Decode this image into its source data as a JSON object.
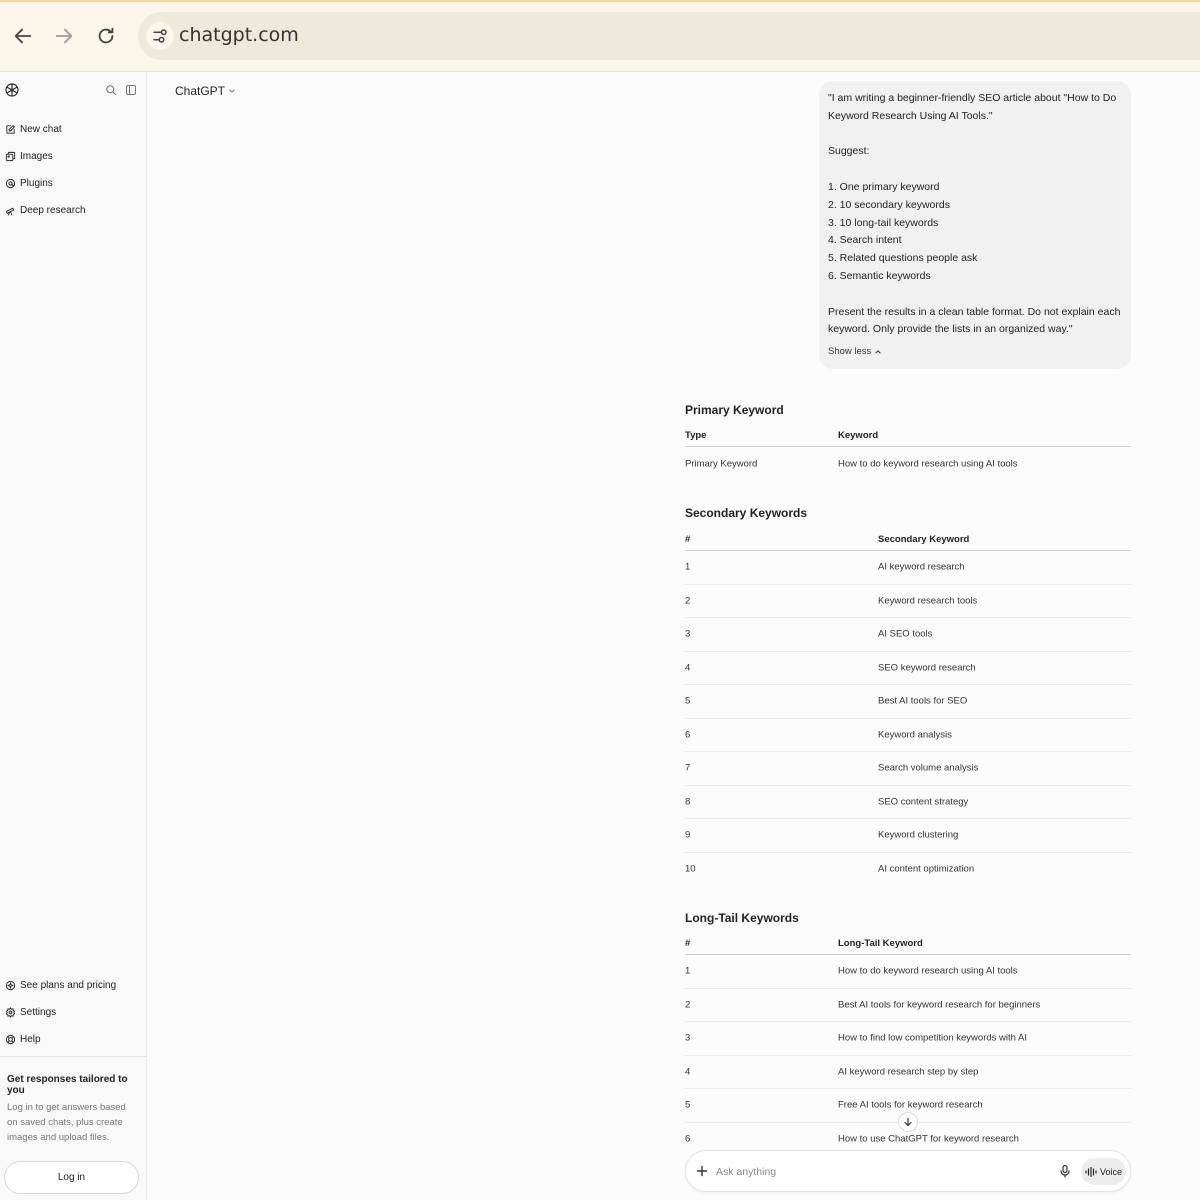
{
  "browser": {
    "url": "chatgpt.com",
    "icons": [
      "back-icon",
      "forward-icon",
      "reload-icon",
      "site-settings-icon"
    ]
  },
  "sidebar": {
    "items": [
      {
        "label": "New chat",
        "icon": "edit-icon"
      },
      {
        "label": "Images",
        "icon": "images-icon"
      },
      {
        "label": "Plugins",
        "icon": "plugins-icon"
      },
      {
        "label": "Deep research",
        "icon": "telescope-icon"
      }
    ],
    "bottom_items": [
      {
        "label": "See plans and pricing",
        "icon": "plans-icon"
      },
      {
        "label": "Settings",
        "icon": "gear-icon"
      },
      {
        "label": "Help",
        "icon": "help-icon"
      }
    ],
    "tailored_title": "Get responses tailored to you",
    "tailored_desc": "Log in to get answers based on saved chats, plus create images and upload files.",
    "login_label": "Log in"
  },
  "header": {
    "model_label": "ChatGPT"
  },
  "user_message": {
    "text": "\"I am writing a beginner-friendly SEO article about \"How to Do Keyword Research Using AI Tools.\"\n\nSuggest:\n\n1. One primary keyword\n2. 10 secondary keywords\n3. 10 long-tail keywords\n4. Search intent\n5. Related questions people ask\n6. Semantic keywords\n\nPresent the results in a clean table format. Do not explain each keyword. Only provide the lists in an organized way.\"",
    "show_less_label": "Show less"
  },
  "primary_keyword": {
    "heading": "Primary Keyword",
    "columns": [
      "Type",
      "Keyword"
    ],
    "rows": [
      [
        "Primary Keyword",
        "How to do keyword research using AI tools"
      ]
    ]
  },
  "secondary_keywords": {
    "heading": "Secondary Keywords",
    "columns": [
      "#",
      "Secondary Keyword"
    ],
    "rows": [
      [
        "1",
        "AI keyword research"
      ],
      [
        "2",
        "Keyword research tools"
      ],
      [
        "3",
        "AI SEO tools"
      ],
      [
        "4",
        "SEO keyword research"
      ],
      [
        "5",
        "Best AI tools for SEO"
      ],
      [
        "6",
        "Keyword analysis"
      ],
      [
        "7",
        "Search volume analysis"
      ],
      [
        "8",
        "SEO content strategy"
      ],
      [
        "9",
        "Keyword clustering"
      ],
      [
        "10",
        "AI content optimization"
      ]
    ]
  },
  "long_tail_keywords": {
    "heading": "Long-Tail Keywords",
    "columns": [
      "#",
      "Long-Tail Keyword"
    ],
    "rows": [
      [
        "1",
        "How to do keyword research using AI tools"
      ],
      [
        "2",
        "Best AI tools for keyword research for beginners"
      ],
      [
        "3",
        "How to find low competition keywords with AI"
      ],
      [
        "4",
        "AI keyword research step by step"
      ],
      [
        "5",
        "Free AI tools for keyword research"
      ],
      [
        "6",
        "How to use ChatGPT for keyword research"
      ]
    ]
  },
  "composer": {
    "placeholder": "Ask anything",
    "voice_label": "Voice"
  }
}
